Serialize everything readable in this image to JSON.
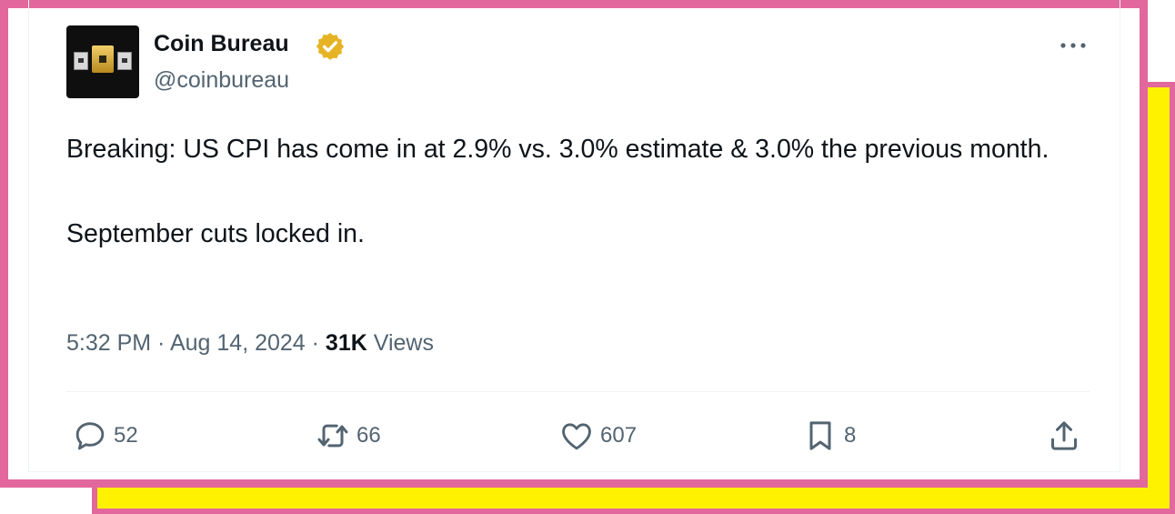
{
  "author": {
    "name": "Coin Bureau",
    "handle": "@coinbureau",
    "verified_badge": "gold-verified-badge-icon"
  },
  "tweet": {
    "line1": "Breaking: US CPI has come in at 2.9% vs. 3.0% estimate & 3.0% the previous month.",
    "line2": "September cuts locked in."
  },
  "meta": {
    "time": "5:32 PM",
    "date": "Aug 14, 2024",
    "views_count": "31K",
    "views_label": "Views"
  },
  "actions": {
    "replies": "52",
    "reposts": "66",
    "likes": "607",
    "bookmarks": "8"
  },
  "colors": {
    "frame_pink": "#e2679d",
    "shadow_yellow": "#fff200",
    "text_primary": "#0f1419",
    "text_secondary": "#536471",
    "badge_gold": "#e6b324"
  }
}
